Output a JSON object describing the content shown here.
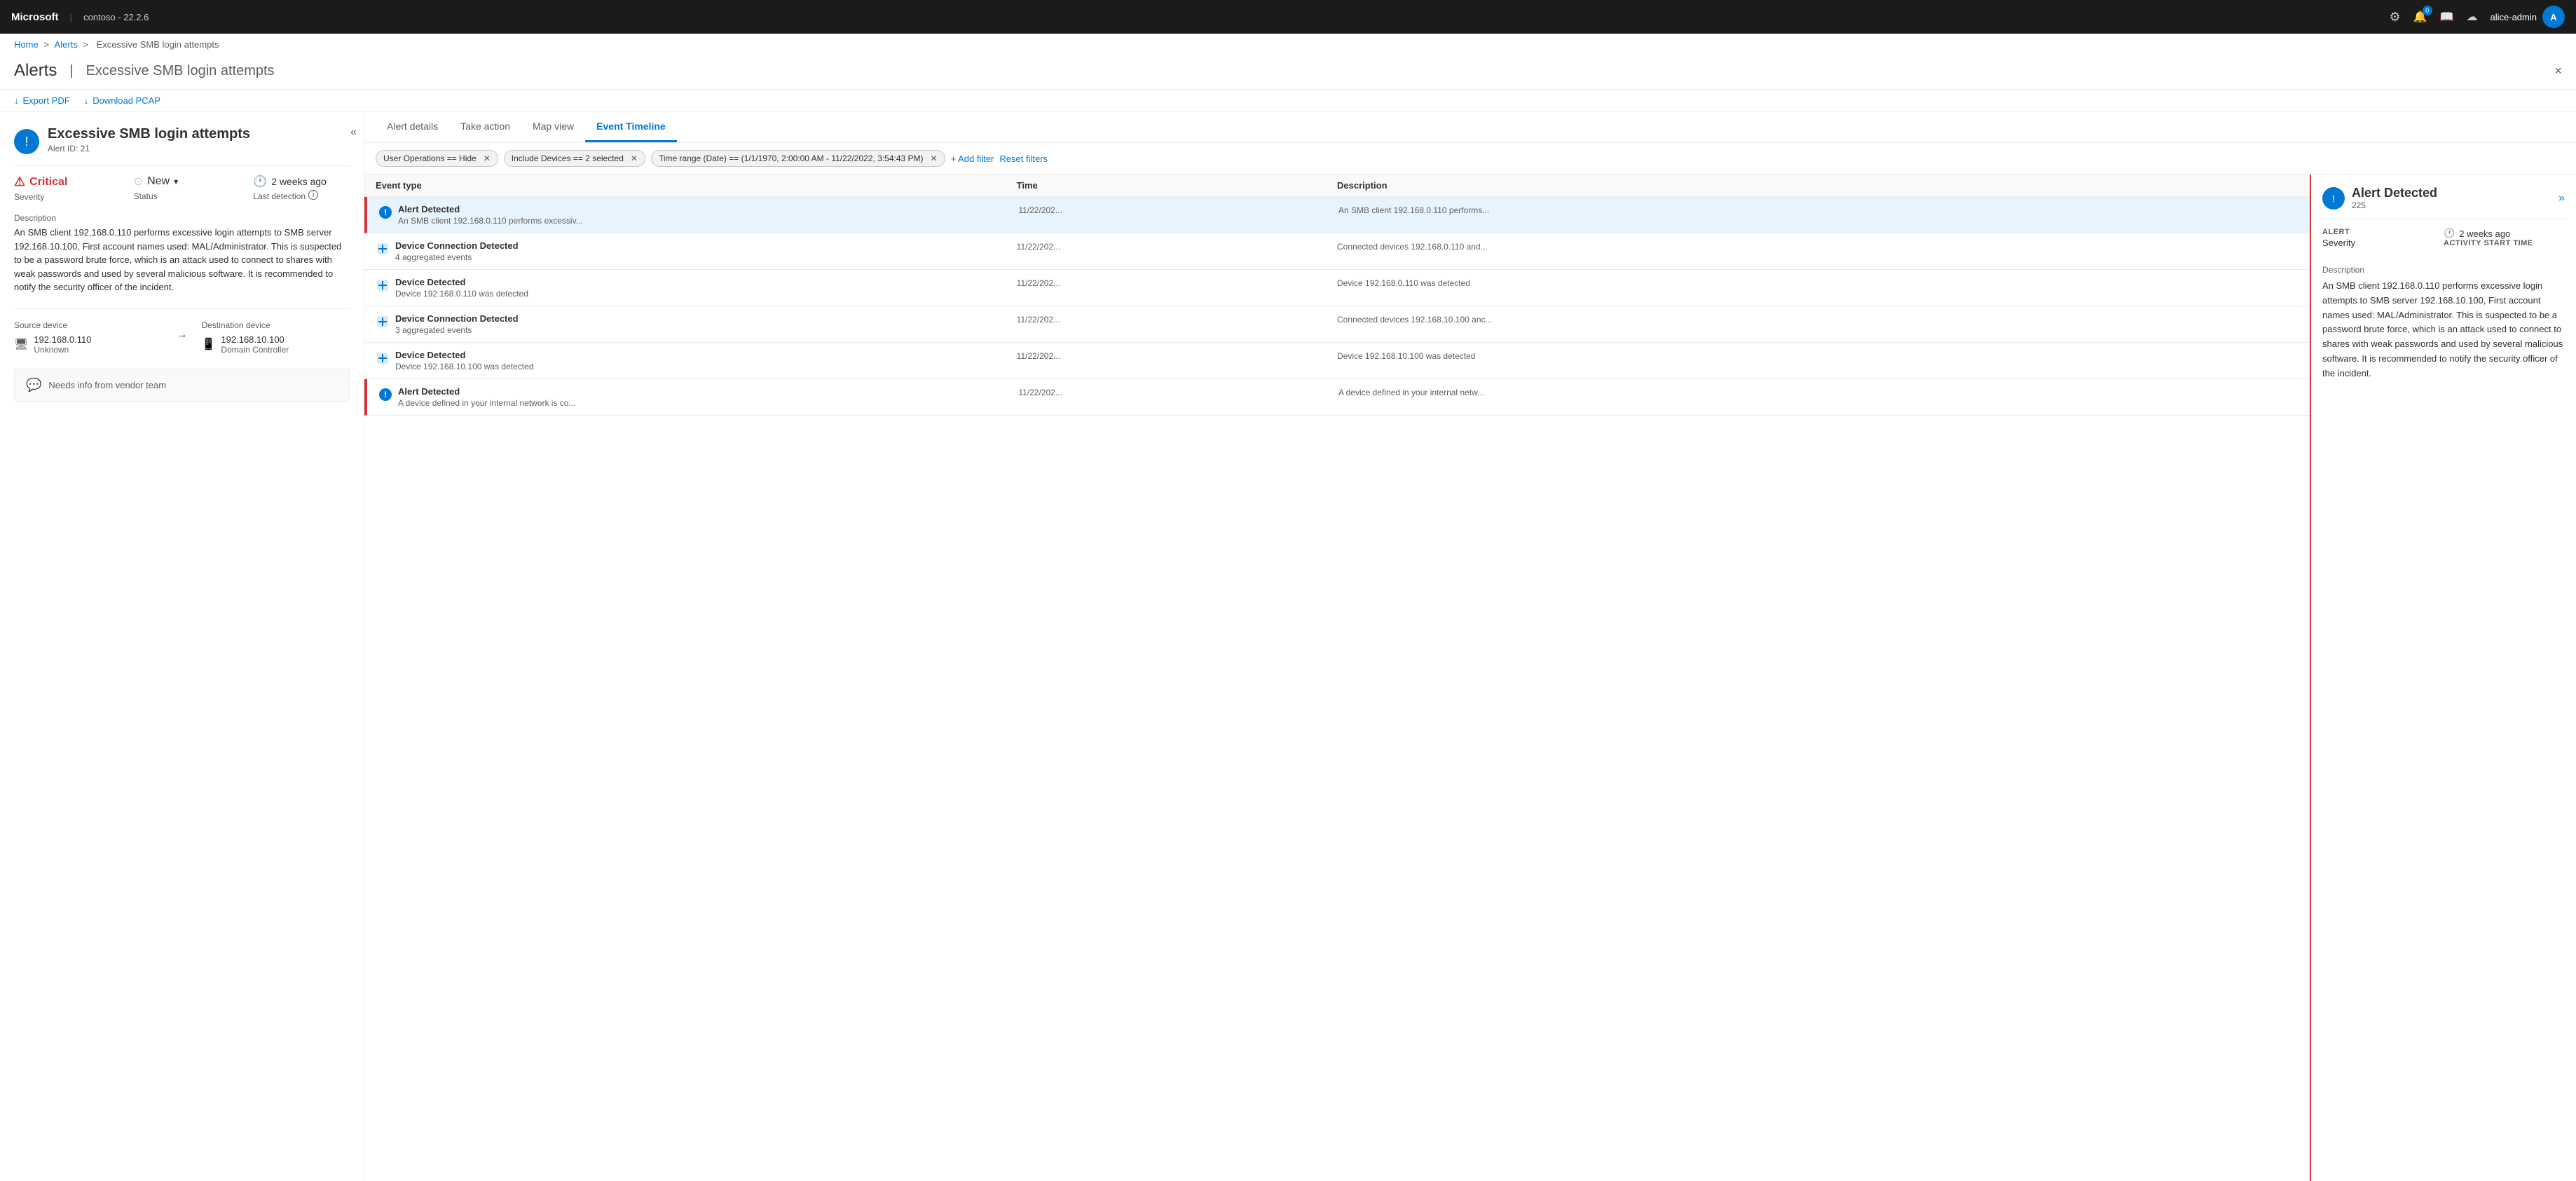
{
  "topbar": {
    "brand": "Microsoft",
    "separator": "|",
    "version": "contoso - 22.2.6",
    "icons": {
      "settings": "⚙",
      "notifications": "🔔",
      "notifications_badge": "0",
      "book": "📖",
      "cloud": "☁"
    },
    "user": {
      "name": "alice-admin",
      "avatar_initial": "A"
    }
  },
  "breadcrumb": {
    "home": "Home",
    "alerts": "Alerts",
    "current": "Excessive SMB login attempts"
  },
  "page": {
    "title": "Alerts",
    "separator": "|",
    "subtitle": "Excessive SMB login attempts",
    "close_label": "×"
  },
  "toolbar": {
    "export_pdf": "Export PDF",
    "download_pcap": "Download PCAP",
    "export_icon": "↓",
    "download_icon": "↓"
  },
  "alert_detail": {
    "icon": "!",
    "title": "Excessive SMB login attempts",
    "alert_id": "Alert ID: 21",
    "severity_label": "Severity",
    "severity_value": "Critical",
    "status_label": "Status",
    "status_value": "New",
    "last_detection_label": "Last detection",
    "last_detection_value": "2 weeks ago",
    "description_label": "Description",
    "description_text": "An SMB client 192.168.0.110 performs excessive login attempts to SMB server 192.168.10.100, First account names used: MAL/Administrator. This is suspected to be a password brute force, which is an attack used to connect to shares with weak passwords and used by several malicious software. It is recommended to notify the security officer of the incident.",
    "source_device_label": "Source device",
    "source_device_ip": "192.168.0.110",
    "source_device_type": "Unknown",
    "destination_device_label": "Destination device",
    "destination_device_ip": "192.168.10.100",
    "destination_device_type": "Domain Controller",
    "comment_text": "Needs info from vendor team",
    "collapse_icon": "«"
  },
  "tabs": [
    {
      "id": "alert-details",
      "label": "Alert details",
      "active": false
    },
    {
      "id": "take-action",
      "label": "Take action",
      "active": false
    },
    {
      "id": "map-view",
      "label": "Map view",
      "active": false
    },
    {
      "id": "event-timeline",
      "label": "Event Timeline",
      "active": true
    }
  ],
  "filters": {
    "filter1": {
      "label": "User Operations == Hide",
      "key": "User Operations",
      "op": "==",
      "value": "Hide"
    },
    "filter2": {
      "label": "Include Devices == 2 selected",
      "key": "Include Devices",
      "op": "==",
      "value": "2 selected"
    },
    "filter3": {
      "label": "Time range (Date) == (1/1/1970, 2:00:00 AM - 11/22/2022, 3:54:43 PM)",
      "key": "Time range (Date)",
      "op": "==",
      "value": "(1/1/1970, 2:00:00 AM - 11/22/2022, 3:54:43 PM)"
    },
    "add_filter_label": "+ Add filter",
    "reset_filters_label": "Reset filters"
  },
  "event_table": {
    "columns": [
      "Event type",
      "Time",
      "Description"
    ],
    "rows": [
      {
        "type": "Alert Detected",
        "subtext": "An SMB client 192.168.0.110 performs excessiv...",
        "time": "11/22/202...",
        "description": "An SMB client 192.168.0.110 performs...",
        "icon": "shield",
        "alert_type": true,
        "selected": true
      },
      {
        "type": "Device Connection Detected",
        "subtext": "4 aggregated events",
        "time": "11/22/202...",
        "description": "Connected devices 192.168.0.110 and...",
        "icon": "device-connection",
        "alert_type": false,
        "selected": false
      },
      {
        "type": "Device Detected",
        "subtext": "Device 192.168.0.110 was detected",
        "time": "11/22/202...",
        "description": "Device 192.168.0.110 was detected",
        "icon": "device",
        "alert_type": false,
        "selected": false
      },
      {
        "type": "Device Connection Detected",
        "subtext": "3 aggregated events",
        "time": "11/22/202...",
        "description": "Connected devices 192.168.10.100 anc...",
        "icon": "device-connection",
        "alert_type": false,
        "selected": false
      },
      {
        "type": "Device Detected",
        "subtext": "Device 192.168.10.100 was detected",
        "time": "11/22/202...",
        "description": "Device 192.168.10.100 was detected",
        "icon": "device",
        "alert_type": false,
        "selected": false
      },
      {
        "type": "Alert Detected",
        "subtext": "A device defined in your internal network is co...",
        "time": "11/22/202...",
        "description": "A device defined in your internal netw...",
        "icon": "shield",
        "alert_type": true,
        "selected": false
      }
    ]
  },
  "detail_panel": {
    "icon": "!",
    "title": "Alert Detected",
    "id": "225",
    "severity_label": "ALERT",
    "severity_sublabel": "Severity",
    "activity_time_label": "Activity start time",
    "activity_time_value": "2 weeks ago",
    "description_label": "Description",
    "description_text": "An SMB client 192.168.0.110 performs excessive login attempts to SMB server 192.168.10.100, First account names used: MAL/Administrator. This is suspected to be a password brute force, which is an attack used to connect to shares with weak passwords and used by several malicious software. It is recommended to notify the security officer of the incident.",
    "nav_icon": "»"
  },
  "colors": {
    "critical": "#d13438",
    "blue": "#0078d4",
    "border": "#edebe9",
    "muted": "#605e5c",
    "background_light": "#faf9f8"
  }
}
